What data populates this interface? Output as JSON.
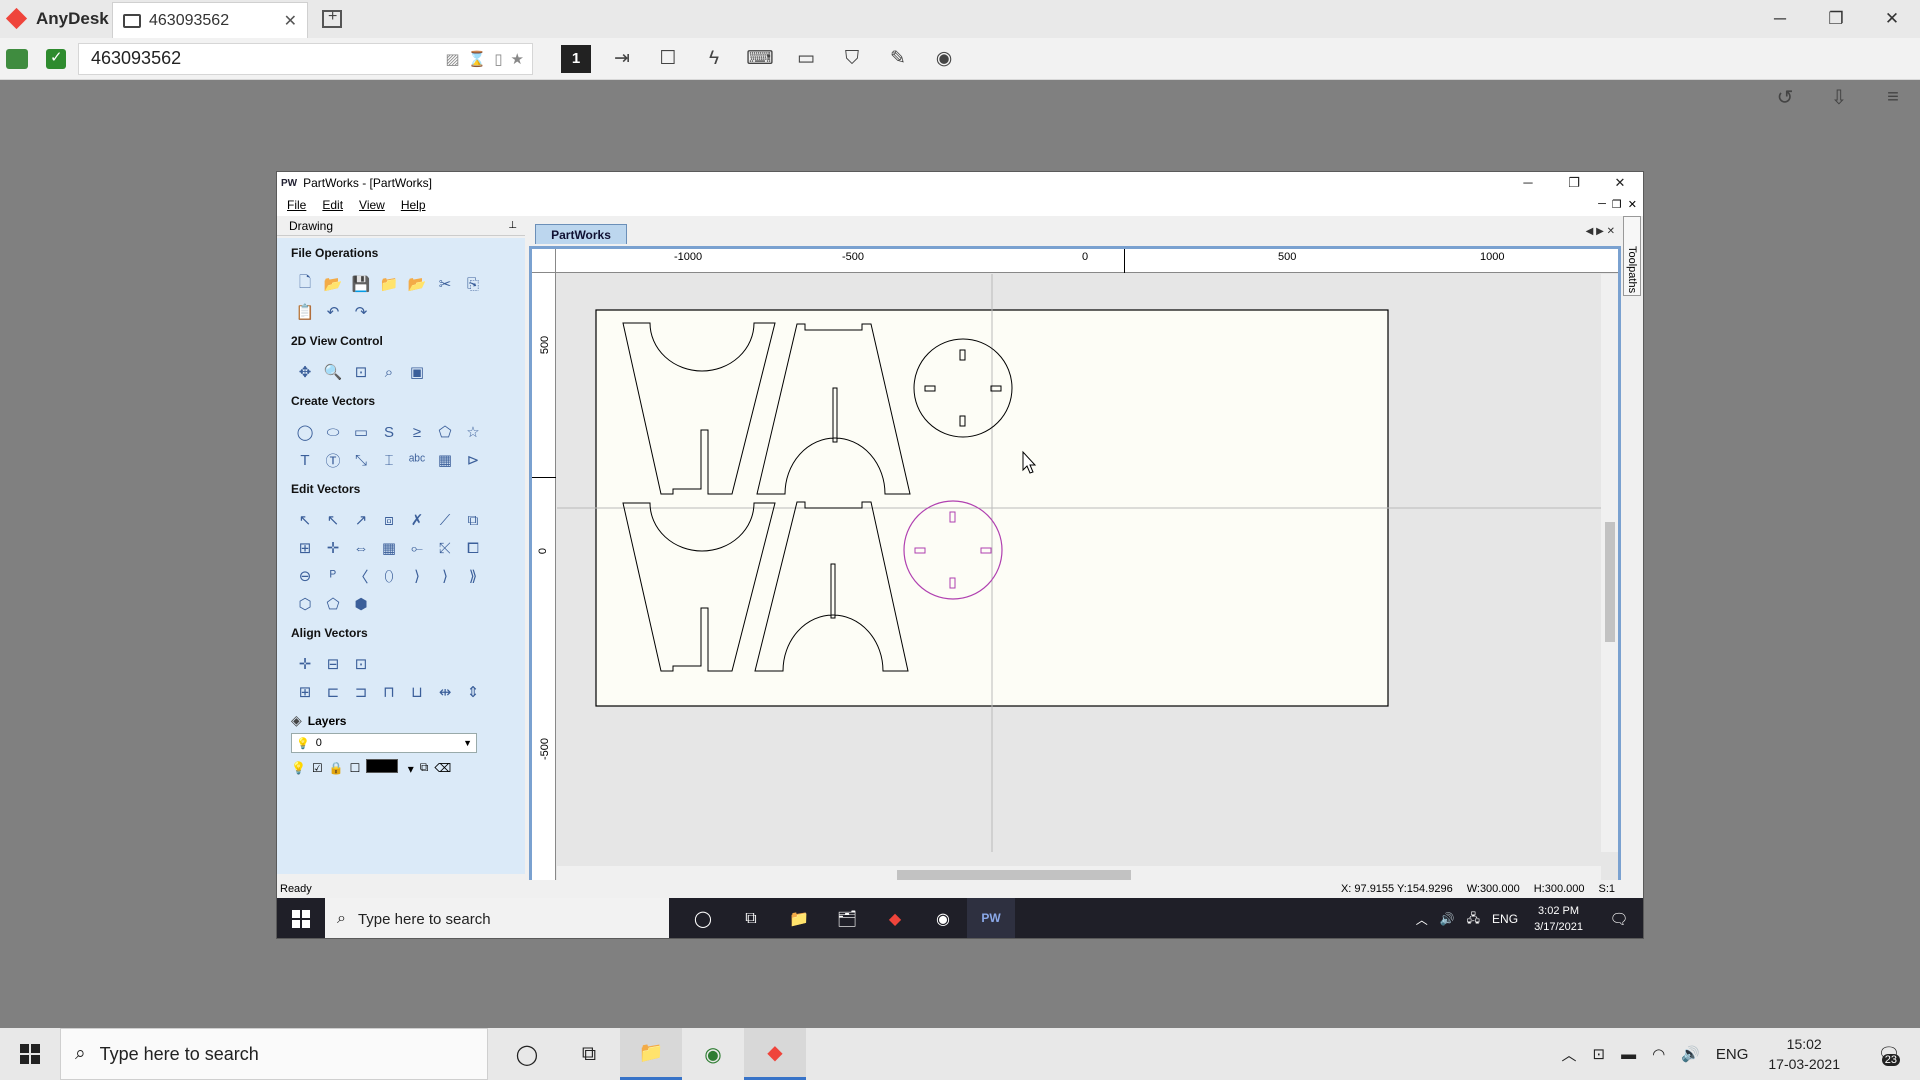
{
  "anydesk": {
    "brand": "AnyDesk",
    "tab_title": "463093562",
    "tab_close": "✕",
    "address_value": "463093562",
    "window_controls": [
      "─",
      "❐",
      "✕"
    ],
    "toolbar_monitor": "1"
  },
  "partworks": {
    "title": "PartWorks - [PartWorks]",
    "logo": "PW",
    "menu": [
      "File",
      "Edit",
      "View",
      "Help"
    ],
    "window_controls": [
      "─",
      "❐",
      "✕"
    ],
    "panel_title": "Drawing",
    "sections": [
      "File Operations",
      "2D View Control",
      "Create Vectors",
      "Edit Vectors",
      "Align Vectors"
    ],
    "layers_label": "Layers",
    "layer_value": "0",
    "doc_tab": "PartWorks",
    "toolpaths_tab": "Toolpaths",
    "ruler_top": [
      "-1000",
      "-500",
      "0",
      "500",
      "1000"
    ],
    "ruler_left": [
      "500",
      "0",
      "-500"
    ],
    "status_ready": "Ready",
    "status_coords": "X: 97.9155 Y:154.9296",
    "status_w": "W:300.000",
    "status_h": "H:300.000",
    "status_s": "S:1"
  },
  "remote_taskbar": {
    "search_placeholder": "Type here to search",
    "lang": "ENG",
    "time": "3:02 PM",
    "date": "3/17/2021"
  },
  "local_taskbar": {
    "search_placeholder": "Type here to search",
    "lang": "ENG",
    "time": "15:02",
    "date": "17-03-2021",
    "notification_count": "23"
  },
  "colors": {
    "selected_vector": "#b040b0",
    "vector_stroke": "#000000",
    "panel_bg": "#dbeaf8",
    "anydesk_red": "#ef443b"
  }
}
